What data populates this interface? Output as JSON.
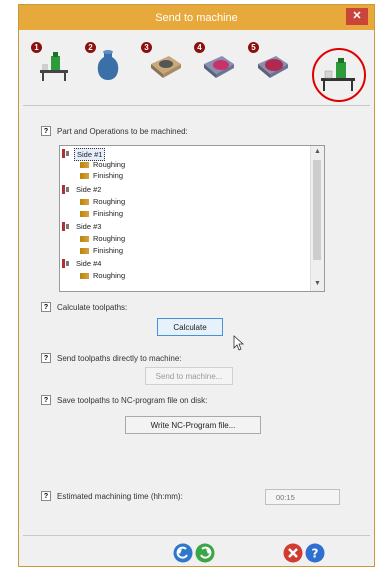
{
  "window": {
    "title": "Send to machine",
    "close_glyph": "✕"
  },
  "steps": [
    {
      "number": "1",
      "icon": "machine-setup-icon"
    },
    {
      "number": "2",
      "icon": "part-model-icon"
    },
    {
      "number": "3",
      "icon": "stock-setup-icon"
    },
    {
      "number": "4",
      "icon": "toolpath-icon"
    },
    {
      "number": "5",
      "icon": "simulation-icon"
    },
    {
      "number": "",
      "icon": "send-to-machine-icon",
      "active": true
    }
  ],
  "help_glyph": "?",
  "sections": {
    "parts_label": "Part and Operations to be machined:",
    "calculate_label": "Calculate toolpaths:",
    "calculate_button": "Calculate",
    "send_label": "Send toolpaths directly to machine:",
    "send_button": "Send to machine...",
    "save_label": "Save toolpaths to NC-program file on disk:",
    "write_button": "Write NC-Program file...",
    "time_label": "Estimated machining time (hh:mm):",
    "time_value": "00:15"
  },
  "tree": [
    {
      "label": "Side #1",
      "type": "side",
      "selected": true
    },
    {
      "label": "Roughing",
      "type": "op"
    },
    {
      "label": "Finishing",
      "type": "op"
    },
    {
      "label": "Side #2",
      "type": "side"
    },
    {
      "label": "Roughing",
      "type": "op"
    },
    {
      "label": "Finishing",
      "type": "op"
    },
    {
      "label": "Side #3",
      "type": "side"
    },
    {
      "label": "Roughing",
      "type": "op"
    },
    {
      "label": "Finishing",
      "type": "op"
    },
    {
      "label": "Side #4",
      "type": "side"
    },
    {
      "label": "Roughing",
      "type": "op"
    }
  ],
  "scroll_glyphs": {
    "up": "▲",
    "down": "▼"
  },
  "colors": {
    "titlebar": "#e8a93c",
    "close": "#c9453a",
    "step_badge": "#8c0f0f",
    "active_ring": "#e00000"
  }
}
